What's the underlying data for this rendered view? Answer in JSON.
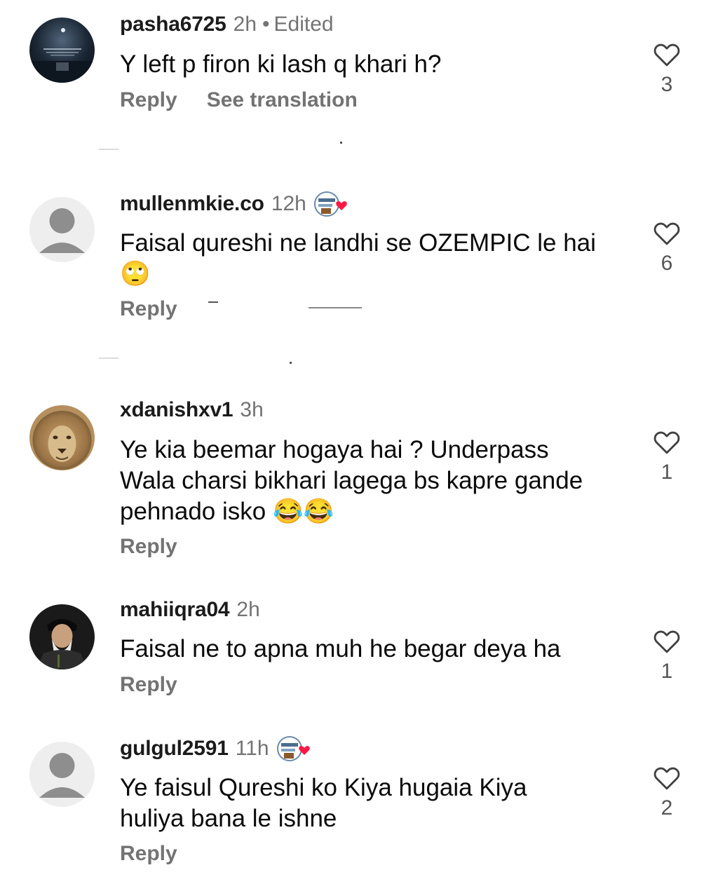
{
  "comments": [
    {
      "username": "pasha6725",
      "time": "2h",
      "edited": "Edited",
      "text": "Y left p firon ki lash q khari h?",
      "reply": "Reply",
      "translation": "See translation",
      "likes": "3",
      "avatar": "night-sea-avatar"
    },
    {
      "username": "mullenmkie.co",
      "time": "12h",
      "text": "Faisal qureshi ne landhi se OZEMPIC le hai 🙄",
      "reply": "Reply",
      "likes": "6",
      "avatar": "default-avatar"
    },
    {
      "username": "xdanishxv1",
      "time": "3h",
      "text": "Ye kia beemar hogaya hai ? Underpass Wala charsi bikhari lagega bs kapre gande pehnado isko 😂😂",
      "reply": "Reply",
      "likes": "1",
      "avatar": "lion-avatar"
    },
    {
      "username": "mahiiqra04",
      "time": "2h",
      "text": "Faisal ne to apna muh he begar deya ha",
      "reply": "Reply",
      "likes": "1",
      "avatar": "bearded-man-avatar"
    },
    {
      "username": "gulgul2591",
      "time": "11h",
      "text": "Ye faisul Qureshi ko Kiya hugaia Kiya huliya bana le ishne",
      "reply": "Reply",
      "likes": "2",
      "avatar": "default-avatar"
    }
  ],
  "colors": {
    "username": "#1b1b1b",
    "secondary": "#737373",
    "heart": "#404040",
    "badge_heart": "#ff1744"
  }
}
